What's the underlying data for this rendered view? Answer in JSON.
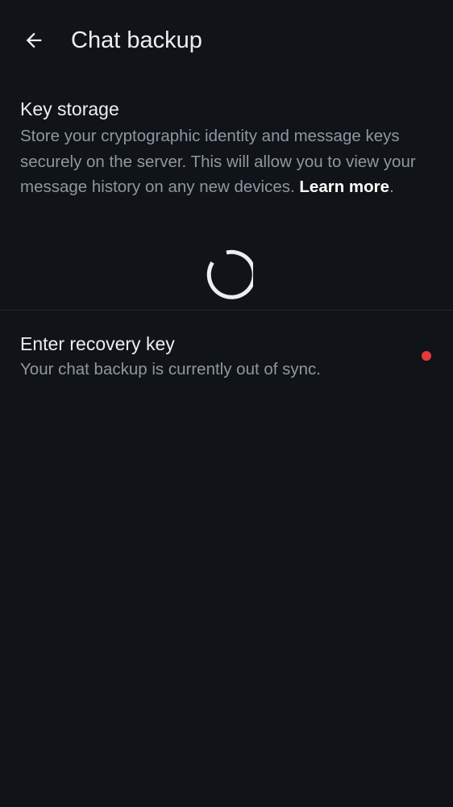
{
  "header": {
    "title": "Chat backup",
    "back_icon": "arrow-left-icon"
  },
  "key_storage": {
    "title": "Key storage",
    "description": "Store your cryptographic identity and message keys securely on the server. This will allow you to view your message history on any new devices. ",
    "learn_more": "Learn more",
    "trailing": ".",
    "status": "loading"
  },
  "recovery": {
    "title": "Enter recovery key",
    "subtitle": "Your chat backup is currently out of sync.",
    "indicator_color": "#e8393a"
  },
  "colors": {
    "background": "#101317",
    "primary_text": "#ebeef2",
    "secondary_text": "#8e97a1",
    "alert": "#e8393a"
  }
}
